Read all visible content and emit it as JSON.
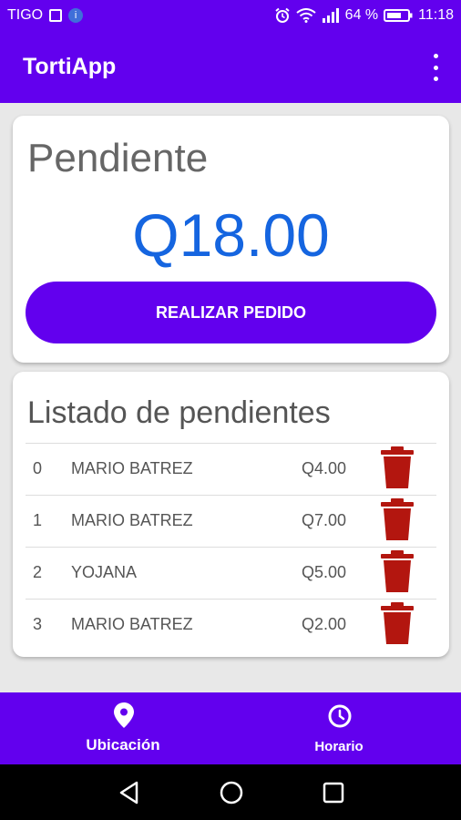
{
  "status_bar": {
    "carrier": "TIGO",
    "battery_percent": "64 %",
    "time": "11:18"
  },
  "app_bar": {
    "title": "TortiApp",
    "menu_icon": "more-vert-icon"
  },
  "pending": {
    "label": "Pendiente",
    "amount": "Q18.00",
    "button_label": "REALIZAR PEDIDO"
  },
  "list": {
    "title": "Listado de pendientes",
    "rows": [
      {
        "index": "0",
        "name": "MARIO BATREZ",
        "amount": "Q4.00"
      },
      {
        "index": "1",
        "name": "MARIO BATREZ",
        "amount": "Q7.00"
      },
      {
        "index": "2",
        "name": "YOJANA",
        "amount": "Q5.00"
      },
      {
        "index": "3",
        "name": "MARIO BATREZ",
        "amount": "Q2.00"
      }
    ],
    "delete_icon": "trash-icon"
  },
  "bottom_nav": {
    "items": [
      {
        "label": "Ubicación",
        "icon": "location-pin-icon"
      },
      {
        "label": "Horario",
        "icon": "clock-icon"
      }
    ]
  },
  "colors": {
    "primary": "#6200ee",
    "amount": "#1565e0",
    "delete": "#b3160f"
  }
}
